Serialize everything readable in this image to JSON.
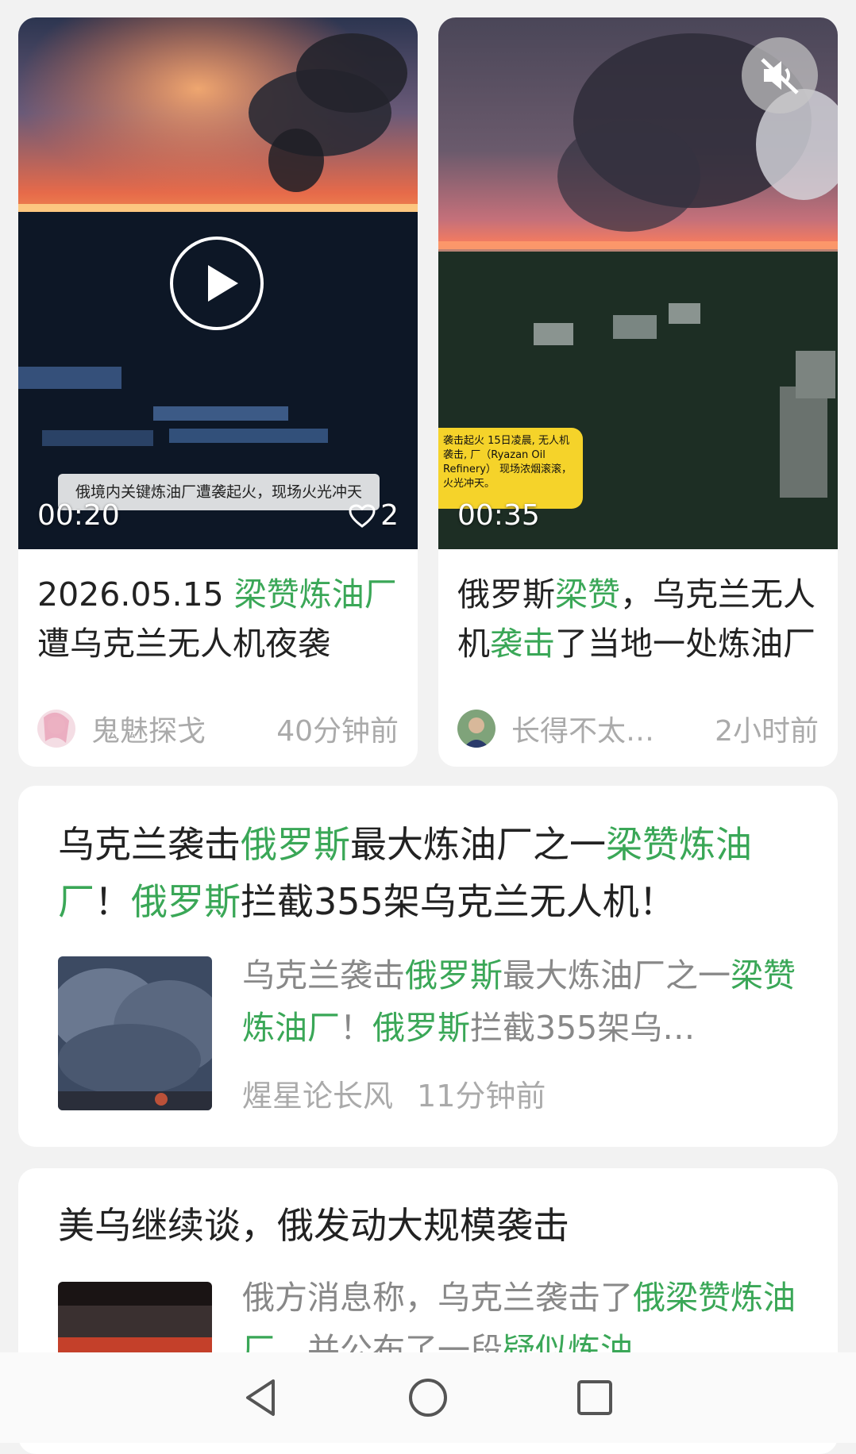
{
  "feed": {
    "video_cards": [
      {
        "duration": "00:20",
        "likes": "2",
        "overlay_caption": "俄境内关键炼油厂遭袭起火，现场火光冲天",
        "title_parts": [
          {
            "text": "2026.05.15 ",
            "highlight": false
          },
          {
            "text": "梁赞炼油厂",
            "highlight": true
          },
          {
            "text": "遭乌克兰无人机夜袭",
            "highlight": false
          }
        ],
        "author": "鬼魅探戈",
        "time": "40分钟前"
      },
      {
        "duration": "00:35",
        "overlay_text": "袭击起火 15日凌晨, 无人机袭击, 厂（Ryazan Oil Refinery） 现场浓烟滚滚，火光冲天。",
        "title_parts": [
          {
            "text": "俄罗斯",
            "highlight": false
          },
          {
            "text": "梁赞",
            "highlight": true
          },
          {
            "text": "，乌克兰无人机",
            "highlight": false
          },
          {
            "text": "袭击",
            "highlight": true
          },
          {
            "text": "了当地一处炼油厂",
            "highlight": false
          }
        ],
        "author": "长得不太…",
        "time": "2小时前"
      }
    ],
    "articles": [
      {
        "title_parts": [
          {
            "text": "乌克兰袭击",
            "highlight": false
          },
          {
            "text": "俄罗斯",
            "highlight": true
          },
          {
            "text": "最大炼油厂之一",
            "highlight": false
          },
          {
            "text": "梁赞炼油厂",
            "highlight": true
          },
          {
            "text": "！",
            "highlight": false
          },
          {
            "text": "俄罗斯",
            "highlight": true
          },
          {
            "text": "拦截355架乌克兰无人机！",
            "highlight": false
          }
        ],
        "summary_parts": [
          {
            "text": "乌克兰袭击",
            "highlight": false
          },
          {
            "text": "俄罗斯",
            "highlight": true
          },
          {
            "text": "最大炼油厂之一",
            "highlight": false
          },
          {
            "text": "梁赞炼油厂",
            "highlight": true
          },
          {
            "text": "！",
            "highlight": false
          },
          {
            "text": "俄罗斯",
            "highlight": true
          },
          {
            "text": "拦截355架乌…",
            "highlight": false
          }
        ],
        "author": "煋星论长风",
        "time": "11分钟前"
      },
      {
        "title_parts": [
          {
            "text": "美乌继续谈，俄发动大规模袭击",
            "highlight": false
          }
        ],
        "summary_parts": [
          {
            "text": "俄方消息称，乌克兰袭击了",
            "highlight": false
          },
          {
            "text": "俄梁赞炼油厂",
            "highlight": true
          },
          {
            "text": "，并公布了一段",
            "highlight": false
          },
          {
            "text": "疑似炼油",
            "highlight": true
          }
        ]
      }
    ]
  },
  "navbar": {
    "icons": [
      "back-triangle-icon",
      "home-circle-icon",
      "recents-square-icon"
    ]
  },
  "colors": {
    "highlight": "#3aa757",
    "background": "#f2f2f2"
  }
}
